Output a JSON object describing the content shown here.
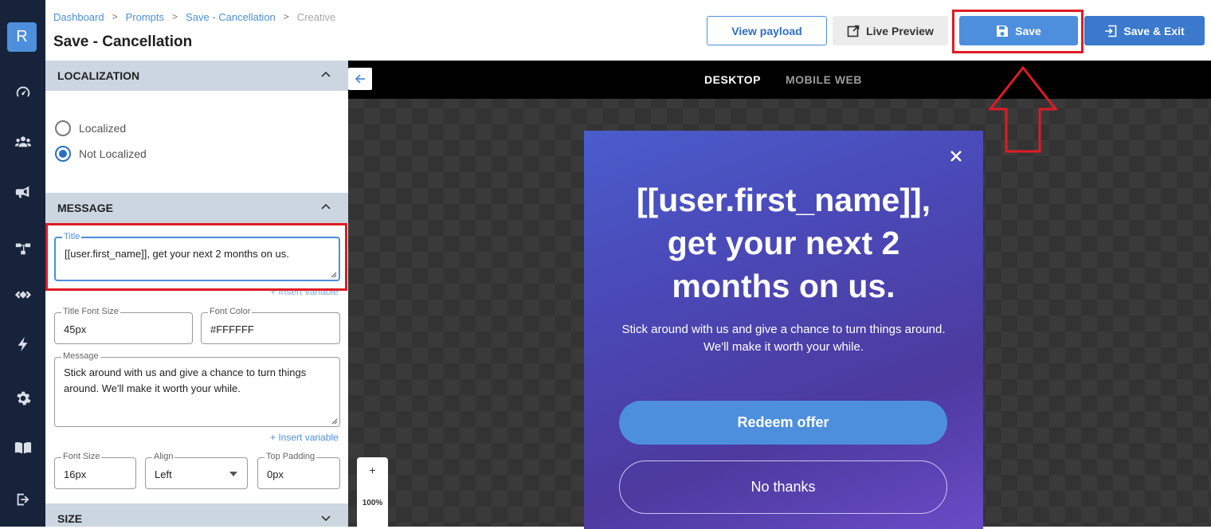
{
  "header": {
    "breadcrumbs": [
      "Dashboard",
      "Prompts",
      "Save - Cancellation",
      "Creative"
    ],
    "title": "Save - Cancellation",
    "buttons": {
      "view_payload": "View payload",
      "live_preview": "Live Preview",
      "save": "Save",
      "save_exit": "Save & Exit"
    }
  },
  "rail": {
    "logo_letter": "R",
    "icons": [
      "dashboard-gauge-icon",
      "users-icon",
      "megaphone-icon",
      "workflow-icon",
      "chevrons-icon",
      "lightning-icon",
      "gear-icon",
      "book-icon",
      "logout-icon"
    ]
  },
  "panel": {
    "localization": {
      "heading": "LOCALIZATION",
      "options": [
        "Localized",
        "Not Localized"
      ],
      "selected": "Not Localized"
    },
    "message": {
      "heading": "MESSAGE",
      "title_label": "Title",
      "title_value": "[[user.first_name]], get your next 2 months on us.",
      "insert_variable": "+ Insert variable",
      "title_font_size_label": "Title Font Size",
      "title_font_size_value": "45px",
      "font_color_label": "Font Color",
      "font_color_value": "#FFFFFF",
      "message_label": "Message",
      "message_value": "Stick around with us and give a chance to turn things around. We'll make it worth your while.",
      "font_size_label": "Font Size",
      "font_size_value": "16px",
      "align_label": "Align",
      "align_value": "Left",
      "top_padding_label": "Top Padding",
      "top_padding_value": "0px"
    },
    "size": {
      "heading": "SIZE"
    }
  },
  "canvas": {
    "tabs": [
      "DESKTOP",
      "MOBILE WEB"
    ],
    "active_tab": "DESKTOP",
    "zoom_plus": "+",
    "zoom_level": "100%"
  },
  "preview": {
    "title": "[[user.first_name]], get your next 2 months on us.",
    "message": "Stick around with us and give a chance to turn things around. We'll make it worth your while.",
    "primary_button": "Redeem offer",
    "secondary_button": "No thanks"
  },
  "colors": {
    "accent": "#4d8fdc",
    "rail": "#17233a",
    "highlight": "#e01b24"
  }
}
